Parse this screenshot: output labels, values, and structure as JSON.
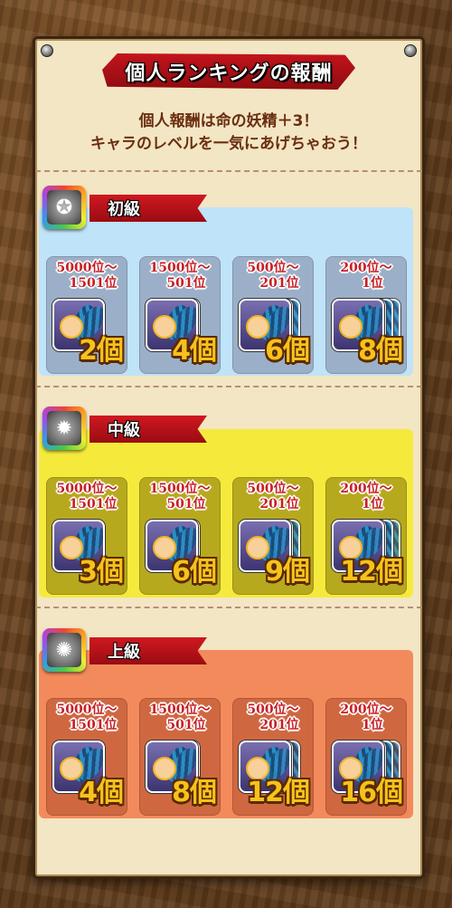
{
  "title": "個人ランキングの報酬",
  "subtitle_line1": "個人報酬は命の妖精＋3！",
  "subtitle_line2": "キャラのレベルを一気にあげちゃおう！",
  "colors": {
    "banner_red": "#c4141c",
    "beginner_bg": "#bfe3f8",
    "intermediate_bg": "#f5ea3c",
    "advanced_bg": "#f38a5c",
    "count_gold": "#f6c21c",
    "rank_red": "#c61e24"
  },
  "tiers": [
    {
      "label": "初級",
      "icon": "medal-icon",
      "rewards": [
        {
          "rank_top": "5000位～",
          "rank_bottom": "1501位",
          "count": "2個"
        },
        {
          "rank_top": "1500位～",
          "rank_bottom": "501位",
          "count": "4個"
        },
        {
          "rank_top": "500位～",
          "rank_bottom": "201位",
          "count": "6個"
        },
        {
          "rank_top": "200位～",
          "rank_bottom": "1位",
          "count": "8個"
        }
      ]
    },
    {
      "label": "中級",
      "icon": "medal-icon",
      "rewards": [
        {
          "rank_top": "5000位～",
          "rank_bottom": "1501位",
          "count": "3個"
        },
        {
          "rank_top": "1500位～",
          "rank_bottom": "501位",
          "count": "6個"
        },
        {
          "rank_top": "500位～",
          "rank_bottom": "201位",
          "count": "9個"
        },
        {
          "rank_top": "200位～",
          "rank_bottom": "1位",
          "count": "12個"
        }
      ]
    },
    {
      "label": "上級",
      "icon": "medal-icon",
      "rewards": [
        {
          "rank_top": "5000位～",
          "rank_bottom": "1501位",
          "count": "4個"
        },
        {
          "rank_top": "1500位～",
          "rank_bottom": "501位",
          "count": "8個"
        },
        {
          "rank_top": "500位～",
          "rank_bottom": "201位",
          "count": "12個"
        },
        {
          "rank_top": "200位～",
          "rank_bottom": "1位",
          "count": "16個"
        }
      ]
    }
  ]
}
